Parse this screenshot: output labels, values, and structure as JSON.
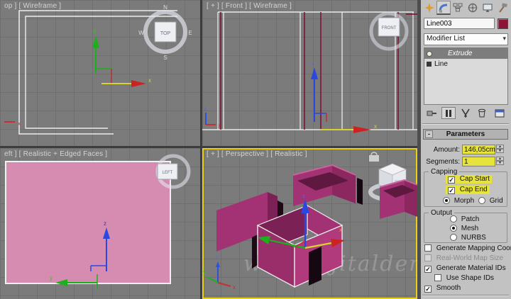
{
  "viewports": {
    "top": {
      "label": "op ] [ Wireframe ]",
      "cube_label": "TOP",
      "compass": {
        "n": "N",
        "w": "W",
        "e": "E",
        "s": "S"
      },
      "axis_x": "x",
      "axis_y": "y"
    },
    "front": {
      "label": "[ + ] [ Front ] [ Wireframe ]",
      "cube_label": "FRONT",
      "axis_x": "x",
      "axis_z": "z"
    },
    "left": {
      "label": "eft ] [ Realistic + Edged Faces ]",
      "cube_label": "LEFT",
      "axis_y": "y",
      "axis_z": "z"
    },
    "perspective": {
      "label": "[ + ] [ Perspective ] [ Realistic ]",
      "watermark": "www.dijitalders",
      "cube_label": "FRONT",
      "axis_x": "x",
      "axis_y": "y",
      "axis_z": "z"
    }
  },
  "command_panel": {
    "tabs": [
      "create",
      "modify",
      "hierarchy",
      "motion",
      "display",
      "utilities"
    ],
    "object_name": "Line003",
    "object_color": "#8c1238",
    "modifier_list_label": "Modifier List",
    "stack": {
      "modifier": "Extrude",
      "base": "Line"
    },
    "stack_toolbar": [
      "pin-stack",
      "show-end-result",
      "make-unique",
      "remove-modifier",
      "configure-modifier-sets"
    ],
    "rollout_title": "Parameters",
    "rollout_collapse": "-",
    "fields": {
      "amount_label": "Amount:",
      "amount_value": "146,05cm",
      "segments_label": "Segments:",
      "segments_value": "1"
    },
    "capping": {
      "title": "Capping",
      "cap_start": "Cap Start",
      "cap_end": "Cap End",
      "morph": "Morph",
      "grid": "Grid"
    },
    "output": {
      "title": "Output",
      "patch": "Patch",
      "mesh": "Mesh",
      "nurbs": "NURBS"
    },
    "checkboxes": [
      {
        "label": "Generate Mapping Coords.",
        "checked": false
      },
      {
        "label": "Real-World Map Size",
        "checked": false,
        "disabled": true
      },
      {
        "label": "Generate Material IDs",
        "checked": true
      },
      {
        "label": "Use Shape IDs",
        "checked": false,
        "indented": true
      },
      {
        "label": "Smooth",
        "checked": true
      }
    ],
    "highlight_color": "#e6e33c"
  }
}
